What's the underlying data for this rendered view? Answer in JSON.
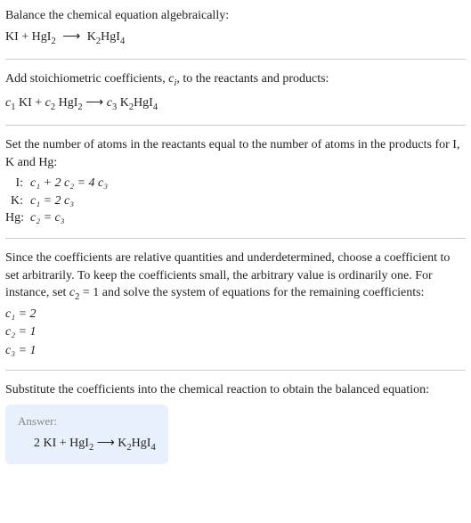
{
  "intro": {
    "line1": "Balance the chemical equation algebraically:",
    "eq_left": "KI + HgI",
    "eq_sub1": "2",
    "eq_arrow": "⟶",
    "eq_right1": "K",
    "eq_sub2": "2",
    "eq_right2": "HgI",
    "eq_sub3": "4"
  },
  "step1": {
    "text1": "Add stoichiometric coefficients, ",
    "ci": "c",
    "ci_sub": "i",
    "text2": ", to the reactants and products:",
    "c1": "c",
    "c1s": "1",
    "sp1": " KI + ",
    "c2": "c",
    "c2s": "2",
    "sp2": " HgI",
    "sub2": "2",
    "arrow": " ⟶ ",
    "c3": "c",
    "c3s": "3",
    "sp3": " K",
    "sub3a": "2",
    "sp4": "HgI",
    "sub3b": "4"
  },
  "step2": {
    "text": "Set the number of atoms in the reactants equal to the number of atoms in the products for I, K and Hg:",
    "rows": [
      {
        "label": "I:",
        "eq": "c₁ + 2 c₂ = 4 c₃"
      },
      {
        "label": "K:",
        "eq": "c₁ = 2 c₃"
      },
      {
        "label": "Hg:",
        "eq": "c₂ = c₃"
      }
    ]
  },
  "step3": {
    "text1": "Since the coefficients are relative quantities and underdetermined, choose a coefficient to set arbitrarily. To keep the coefficients small, the arbitrary value is ordinarily one. For instance, set ",
    "c2": "c",
    "c2s": "2",
    "text2": " = 1 and solve the system of equations for the remaining coefficients:",
    "lines": [
      "c₁ = 2",
      "c₂ = 1",
      "c₃ = 1"
    ]
  },
  "step4": {
    "text": "Substitute the coefficients into the chemical reaction to obtain the balanced equation:"
  },
  "answer": {
    "label": "Answer:",
    "eq1": "2 KI + HgI",
    "sub1": "2",
    "arrow": " ⟶ ",
    "eq2": "K",
    "sub2": "2",
    "eq3": "HgI",
    "sub3": "4"
  }
}
